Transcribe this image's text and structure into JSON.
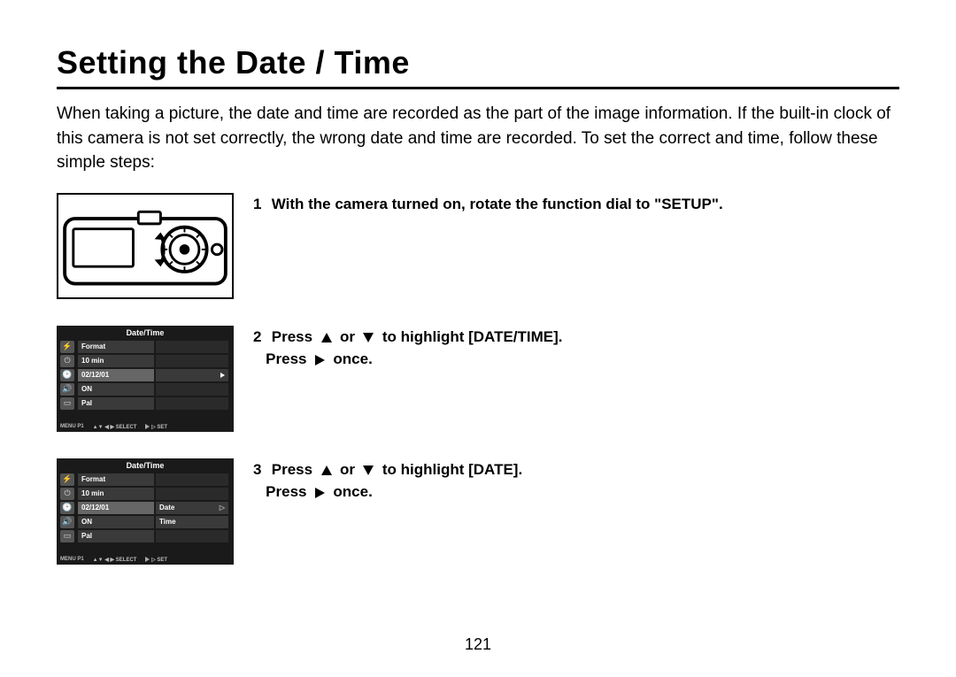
{
  "title": "Setting the Date / Time",
  "intro": "When taking a picture, the date and time are recorded as the part of the image information. If the built-in clock of this camera is not set correctly, the wrong date and time are recorded. To set the correct and time, follow these simple steps:",
  "steps": [
    {
      "n": "1",
      "before": "With the camera turned on, rotate the function dial to \"SETUP\".",
      "after": ""
    },
    {
      "n": "2",
      "before": "Press",
      "mid": "to highlight [DATE/TIME].",
      "line2a": "Press",
      "line2b": "once."
    },
    {
      "n": "3",
      "before": "Press",
      "mid": "to highlight [DATE].",
      "line2a": "Press",
      "line2b": "once."
    }
  ],
  "lcd": {
    "title": "Date/Time",
    "rows": [
      "Format",
      "10 min",
      "02/12/01",
      "ON",
      "Pal"
    ],
    "right3": [
      {
        "label": "",
        "mark": "▶",
        "sel": true
      },
      {
        "label": "",
        "mark": "",
        "sel": false
      },
      {
        "label": "",
        "mark": "",
        "sel": false
      }
    ],
    "right3b": [
      {
        "label": "Date",
        "mark": "▷",
        "sel": true
      },
      {
        "label": "Time",
        "mark": "",
        "sel": false
      },
      {
        "label": "",
        "mark": "",
        "sel": false
      }
    ],
    "foot": {
      "a": "MENU P1",
      "b": "▲▼  ◀ ▶ SELECT",
      "c": "▷ SET"
    }
  },
  "or": "or",
  "page": "121"
}
